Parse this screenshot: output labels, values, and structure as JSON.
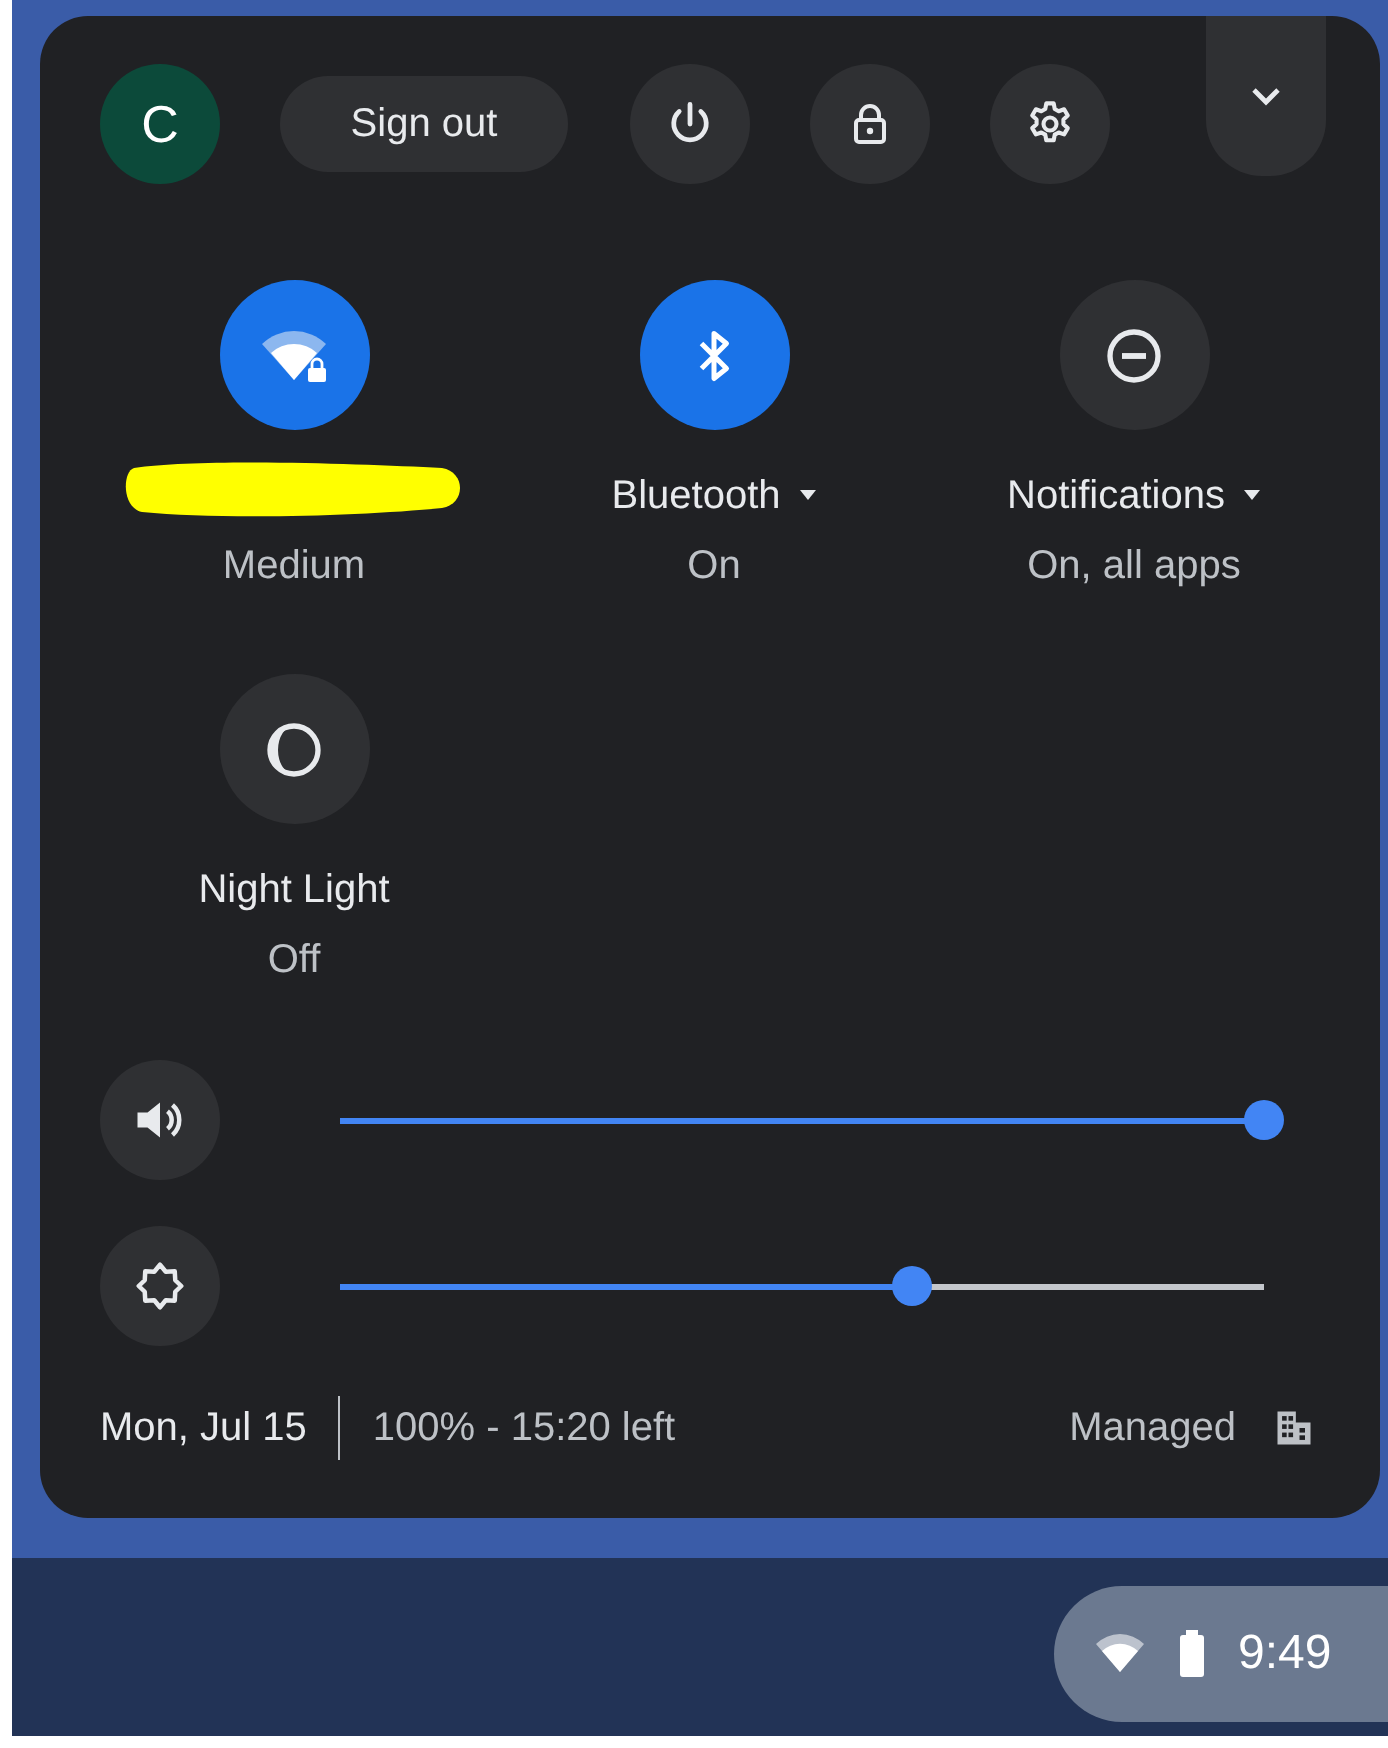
{
  "user": {
    "initial": "C"
  },
  "top_bar": {
    "sign_out": "Sign out"
  },
  "feature_pods": [
    {
      "kind": "wifi",
      "on": true,
      "label_redacted": true,
      "has_menu": false,
      "sublabel": "Medium"
    },
    {
      "kind": "bluetooth",
      "on": true,
      "label": "Bluetooth",
      "has_menu": true,
      "sublabel": "On"
    },
    {
      "kind": "notifications",
      "on": false,
      "label": "Notifications",
      "has_menu": true,
      "sublabel": "On, all apps"
    },
    {
      "kind": "night_light",
      "on": false,
      "label": "Night Light",
      "has_menu": false,
      "sublabel": "Off"
    }
  ],
  "sliders": [
    {
      "kind": "volume",
      "level": 1.0
    },
    {
      "kind": "brightness",
      "level": 0.62
    }
  ],
  "footer": {
    "date": "Mon, Jul 15",
    "battery": "100% - 15:20 left",
    "managed": "Managed"
  },
  "tray": {
    "time": "9:49"
  }
}
